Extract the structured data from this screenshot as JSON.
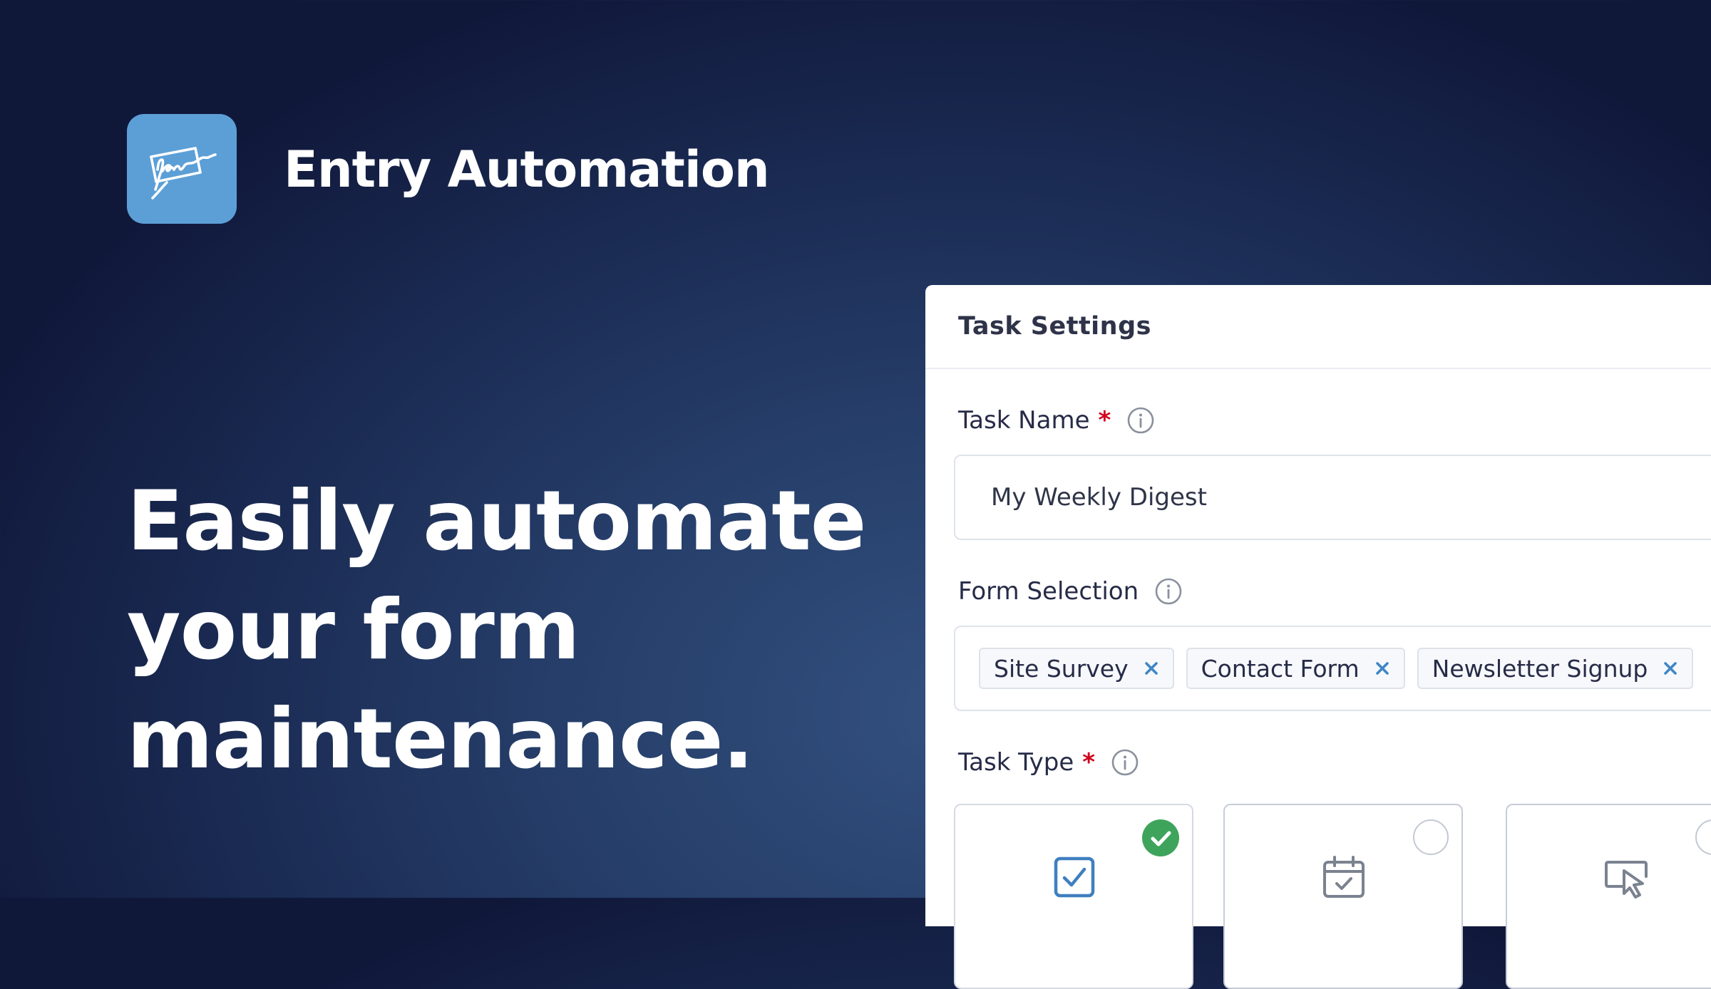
{
  "brand": {
    "name": "Entry Automation",
    "logo_icon": "signature-icon",
    "logo_color": "#5c9fd6"
  },
  "headline": {
    "lines": [
      "Easily automate",
      "your form",
      "maintenance."
    ]
  },
  "panel": {
    "title": "Task Settings",
    "task_name": {
      "label": "Task Name",
      "required_mark": "*",
      "info_icon": "info-icon",
      "value": "My Weekly Digest"
    },
    "form_selection": {
      "label": "Form Selection",
      "info_icon": "info-icon",
      "chips": [
        {
          "label": "Site Survey",
          "remove_icon": "close-icon"
        },
        {
          "label": "Contact Form",
          "remove_icon": "close-icon"
        },
        {
          "label": "Newsletter Signup",
          "remove_icon": "close-icon"
        }
      ]
    },
    "task_type": {
      "label": "Task Type",
      "required_mark": "*",
      "info_icon": "info-icon",
      "options": [
        {
          "icon": "checkbox-checked-icon",
          "selected": true
        },
        {
          "icon": "calendar-check-icon",
          "selected": false
        },
        {
          "icon": "cursor-click-icon",
          "selected": false
        }
      ]
    }
  },
  "colors": {
    "required": "#d0021b",
    "chip_remove": "#3f86c7",
    "selected_check": "#3fa45b",
    "type_icon_active": "#3f7fc0",
    "type_icon_inactive": "#7b8290"
  }
}
